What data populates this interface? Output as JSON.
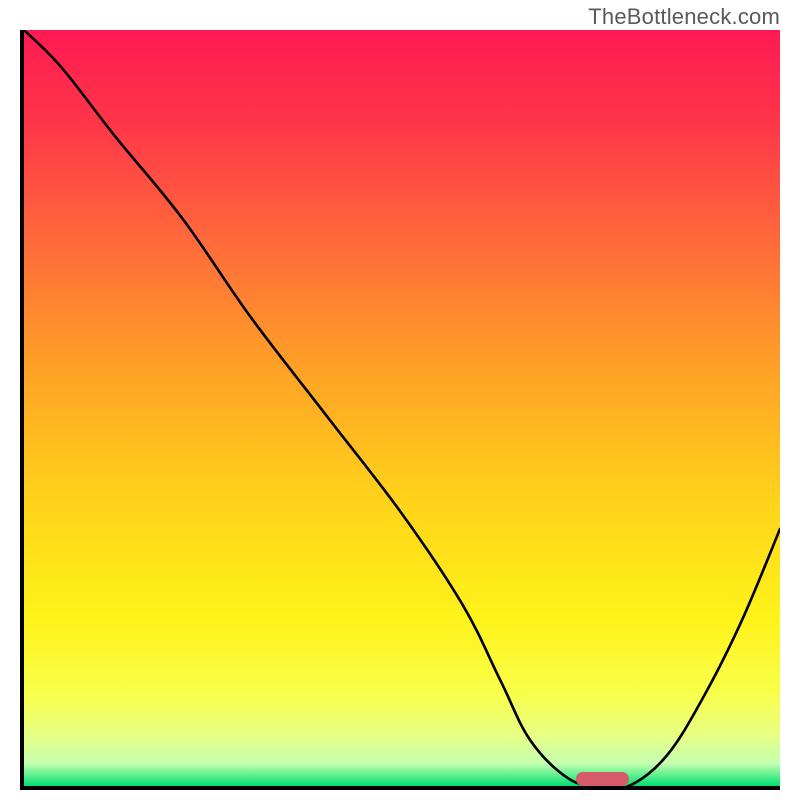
{
  "watermark": "TheBottleneck.com",
  "chart_data": {
    "type": "line",
    "title": "",
    "xlabel": "",
    "ylabel": "",
    "x_range": [
      0,
      100
    ],
    "y_range": [
      0,
      100
    ],
    "series": [
      {
        "name": "bottleneck-curve",
        "x": [
          0,
          5,
          12,
          21,
          30,
          40,
          50,
          58,
          63,
          67,
          72,
          76,
          80,
          85,
          90,
          95,
          100
        ],
        "y": [
          100,
          95,
          86,
          75,
          62,
          49,
          36,
          24,
          14,
          6,
          1,
          0,
          0,
          4,
          12,
          22,
          34
        ]
      }
    ],
    "marker": {
      "name": "optimal-range",
      "x_start": 73,
      "x_end": 80,
      "y": 0
    },
    "gradient": {
      "stops": [
        {
          "offset": 0.0,
          "color": "#ff1a53"
        },
        {
          "offset": 0.12,
          "color": "#ff3549"
        },
        {
          "offset": 0.28,
          "color": "#ff6a3a"
        },
        {
          "offset": 0.45,
          "color": "#ffa226"
        },
        {
          "offset": 0.62,
          "color": "#ffd21a"
        },
        {
          "offset": 0.78,
          "color": "#fff31a"
        },
        {
          "offset": 0.88,
          "color": "#f8ff4d"
        },
        {
          "offset": 0.93,
          "color": "#e8ff80"
        },
        {
          "offset": 0.97,
          "color": "#c6ffb0"
        },
        {
          "offset": 1.0,
          "color": "#00e070"
        }
      ]
    }
  }
}
